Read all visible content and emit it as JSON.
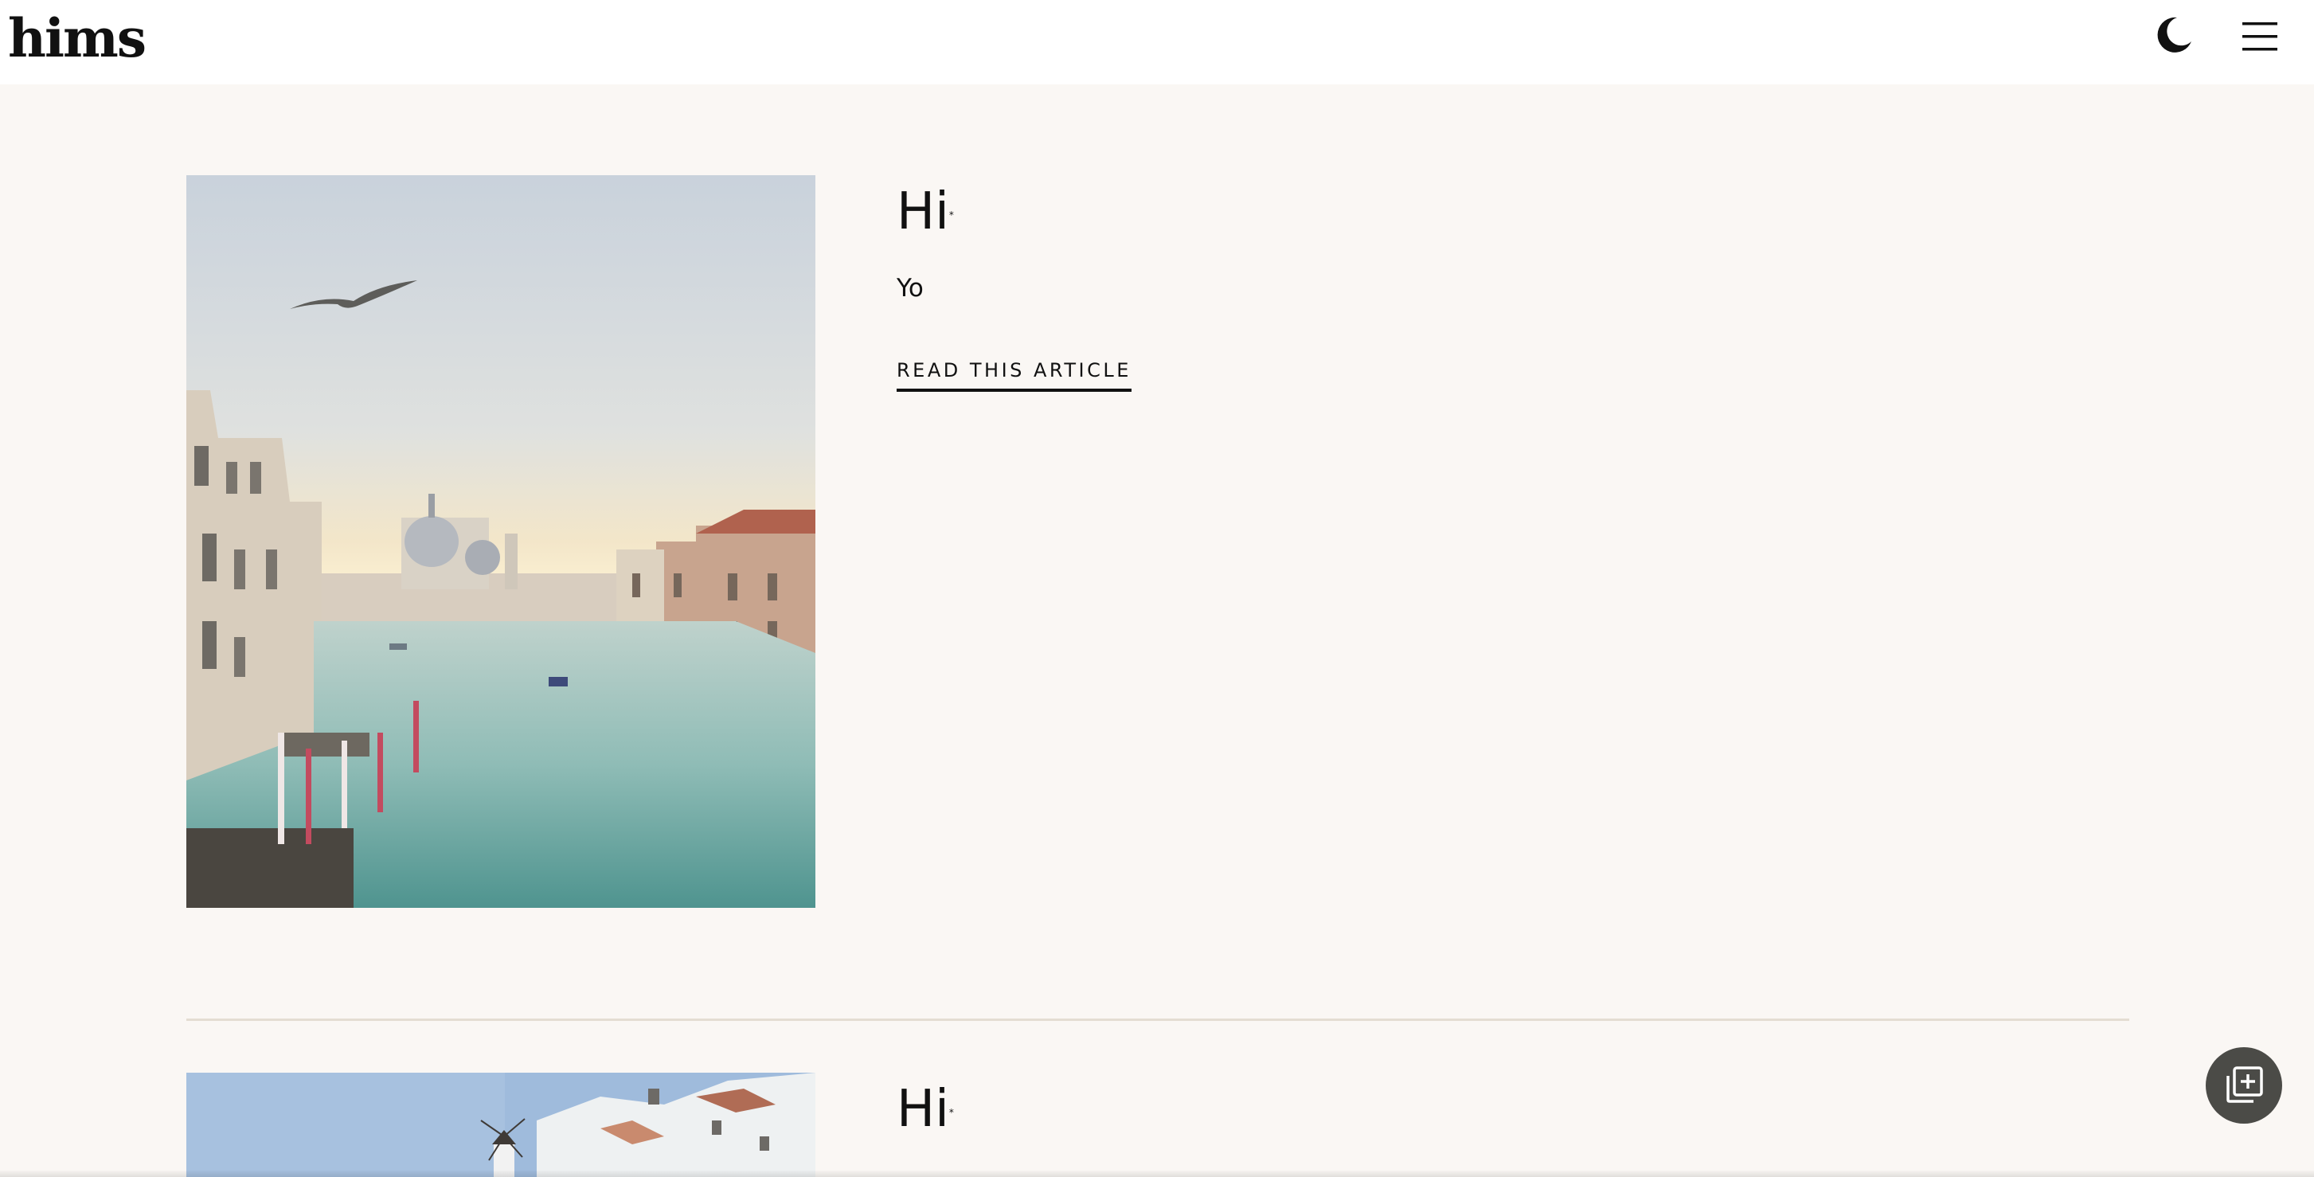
{
  "header": {
    "logo_text": "hims",
    "theme_toggle_icon": "moon-icon",
    "menu_icon": "hamburger-menu-icon"
  },
  "articles": [
    {
      "title": "Hi",
      "title_mark": "*",
      "subtitle": "Yo",
      "link_label": "READ THIS ARTICLE",
      "image": "venice-grand-canal-photo"
    },
    {
      "title": "Hi",
      "title_mark": "*",
      "image": "santorini-village-photo"
    }
  ],
  "fab": {
    "icon": "add-to-collection-icon"
  },
  "colors": {
    "page_background": "#faf7f4",
    "header_background": "#ffffff",
    "divider": "#e4ddd2",
    "fab_background": "#4b4b47",
    "text": "#111111"
  }
}
